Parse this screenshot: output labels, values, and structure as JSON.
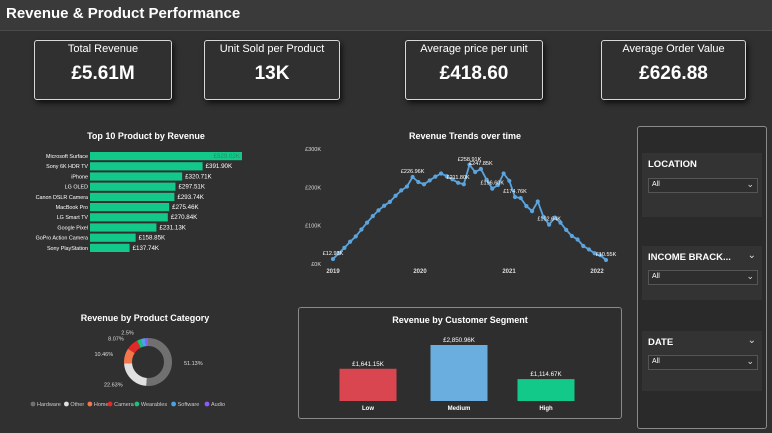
{
  "header": {
    "title": "Revenue & Product Performance"
  },
  "kpis": [
    {
      "label": "Total Revenue",
      "value": "£5.61M"
    },
    {
      "label": "Unit Sold per Product",
      "value": "13K"
    },
    {
      "label": "Average price per unit",
      "value": "£418.60"
    },
    {
      "label": "Average Order Value",
      "value": "£626.88"
    }
  ],
  "colors": {
    "bar_green": "#12c98a",
    "line_blue": "#5ba4dd",
    "low_red": "#d9464f",
    "medium_blue": "#6aaee0",
    "high_green": "#12c98a"
  },
  "filters": [
    {
      "label": "LOCATION",
      "value": "All"
    },
    {
      "label": "INCOME BRACK...",
      "value": "All"
    },
    {
      "label": "DATE",
      "value": "All"
    }
  ],
  "chart_data": [
    {
      "type": "bar",
      "orientation": "horizontal",
      "title": "Top 10 Product by Revenue",
      "categories": [
        "Microsoft Surface",
        "Sony 6K HDR TV",
        "iPhone",
        "LG OLED",
        "Canon DSLR Camera",
        "MacBook Pro",
        "LG Smart TV",
        "Google Pixel",
        "GoPro Action Camera",
        "Sony PlayStation"
      ],
      "values": [
        529.02,
        391.9,
        320.71,
        297.51,
        293.74,
        275.46,
        270.84,
        231.13,
        158.85,
        137.74
      ],
      "value_labels": [
        "£529.02K",
        "£391.90K",
        "£320.71K",
        "£297.51K",
        "£293.74K",
        "£275.46K",
        "£270.84K",
        "£231.13K",
        "£158.85K",
        "£137.74K"
      ],
      "unit": "£K"
    },
    {
      "type": "line",
      "title": "Revenue Trends over time",
      "y_ticks": [
        "£0K",
        "£100K",
        "£200K",
        "£300K"
      ],
      "x_ticks": [
        "2019",
        "2020",
        "2021",
        "2022"
      ],
      "ylim": [
        0,
        300
      ],
      "values": [
        12.93,
        28,
        42,
        58,
        72,
        90,
        108,
        125,
        140,
        152,
        162,
        178,
        192,
        202,
        226.96,
        214,
        208,
        218,
        228,
        236,
        229,
        221,
        211.8,
        208,
        258.91,
        240,
        247.85,
        220,
        196.6,
        206,
        236,
        217,
        174.76,
        172,
        151,
        138,
        163,
        123,
        102.64,
        121,
        108,
        89,
        73,
        64,
        47,
        38,
        28,
        23,
        10.55
      ],
      "point_labels": [
        {
          "index": 0,
          "text": "£12.93K"
        },
        {
          "index": 14,
          "text": "£226.96K"
        },
        {
          "index": 22,
          "text": "£211.80K"
        },
        {
          "index": 24,
          "text": "£258.91K"
        },
        {
          "index": 26,
          "text": "£247.85K"
        },
        {
          "index": 28,
          "text": "£196.60K"
        },
        {
          "index": 32,
          "text": "£174.76K"
        },
        {
          "index": 38,
          "text": "£102.64K"
        },
        {
          "index": 48,
          "text": "£10.55K"
        }
      ]
    },
    {
      "type": "pie",
      "donut": true,
      "title": "Revenue by Product Category",
      "slices": [
        {
          "name": "Hardware",
          "value": 51.13,
          "label": "51.13%",
          "color": "#707070"
        },
        {
          "name": "Other",
          "value": 22.63,
          "label": "22.63%",
          "color": "#e0e0e0"
        },
        {
          "name": "Home",
          "value": 10.46,
          "label": "10.46%",
          "color": "#f2784b"
        },
        {
          "name": "Camera",
          "value": 8.07,
          "label": "8.07%",
          "color": "#e02a2a"
        },
        {
          "name": "Wearables",
          "value": 2.5,
          "label": "2.5%",
          "color": "#1fbf7a"
        },
        {
          "name": "Software",
          "value": 3.2,
          "label": "",
          "color": "#4aa3e0"
        },
        {
          "name": "Audio",
          "value": 2.01,
          "label": "",
          "color": "#8a5cf5"
        }
      ],
      "legend": [
        "Hardware",
        "Other",
        "Home",
        "Camera",
        "Wearables",
        "Software",
        "Audio"
      ]
    },
    {
      "type": "bar",
      "title": "Revenue by Customer Segment",
      "categories": [
        "Low",
        "Medium",
        "High"
      ],
      "values": [
        1641.15,
        2850.96,
        1114.67
      ],
      "value_labels": [
        "£1,641.15K",
        "£2,850.96K",
        "£1,114.67K"
      ],
      "colors": [
        "#d9464f",
        "#6aaee0",
        "#12c98a"
      ],
      "unit": "£K"
    }
  ]
}
